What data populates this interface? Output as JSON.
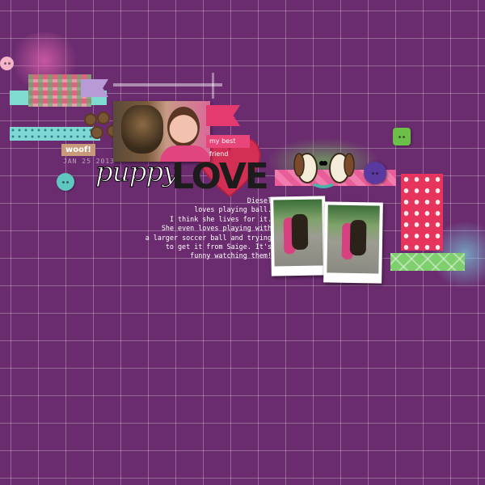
{
  "page": {
    "title_word_1": "puppy",
    "title_word_2": "LOVE",
    "date": "JAN 25 2013",
    "tags": {
      "woof": "woof!",
      "best_friend": "my best friend"
    },
    "journal": "Diesel\nloves playing ball.\nI think she lives for it.\nShe even loves playing with\na larger soccer ball and trying\nto get it from Saige. It's\nfunny watching them!"
  },
  "colors": {
    "background": "#6b2c6f",
    "grid_lines": "#ffffff",
    "accent_pink": "#e8457a",
    "accent_teal": "#7fdad0",
    "accent_green": "#7fcf6f",
    "button_purple": "#5a3aa0",
    "heart_red": "#d32f55"
  },
  "icons": [
    "pink-button-icon",
    "teal-button-icon",
    "green-button-icon",
    "purple-button-icon",
    "paw-print-icon",
    "heart-icon",
    "cartoon-dogs-icon"
  ]
}
